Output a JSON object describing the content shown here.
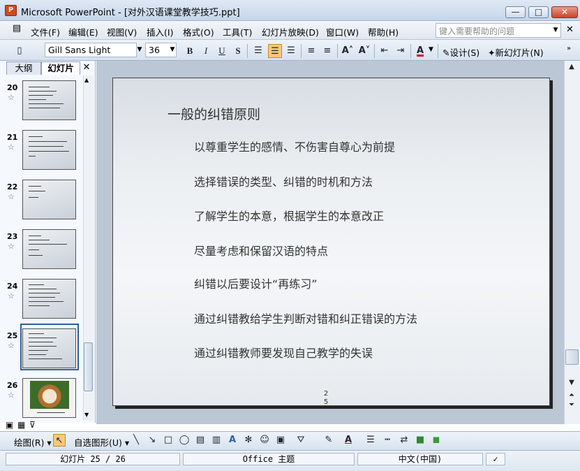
{
  "window": {
    "title": "Microsoft PowerPoint - [对外汉语课堂教学技巧.ppt]",
    "app_icon": "P"
  },
  "menu": {
    "items": [
      "文件(F)",
      "编辑(E)",
      "视图(V)",
      "插入(I)",
      "格式(O)",
      "工具(T)",
      "幻灯片放映(D)",
      "窗口(W)",
      "帮助(H)"
    ],
    "help_placeholder": "键入需要帮助的问题"
  },
  "toolbar": {
    "font": "Gill Sans Light",
    "size": "36",
    "design_label": "设计(S)",
    "new_slide_label": "新幻灯片(N)"
  },
  "panel": {
    "tab_outline": "大纲",
    "tab_slides": "幻灯片",
    "slide_numbers": [
      "20",
      "21",
      "22",
      "23",
      "24",
      "25",
      "26"
    ]
  },
  "slide": {
    "title": "一般的纠错原则",
    "bullets": [
      "以尊重学生的感情、不伤害自尊心为前提",
      "选择错误的类型、纠错的时机和方法",
      "了解学生的本意，根据学生的本意改正",
      "尽量考虑和保留汉语的特点",
      "纠错以后要设计“再练习”",
      "通过纠错教给学生判断对错和纠正错误的方法",
      "通过纠错教师要发现自己教学的失误"
    ],
    "number": "25"
  },
  "drawbar": {
    "draw_label": "绘图(R)",
    "autoshape_label": "自选图形(U)"
  },
  "status": {
    "slide_info": "幻灯片 25 / 26",
    "theme": "Office 主题",
    "language": "中文(中国)"
  }
}
